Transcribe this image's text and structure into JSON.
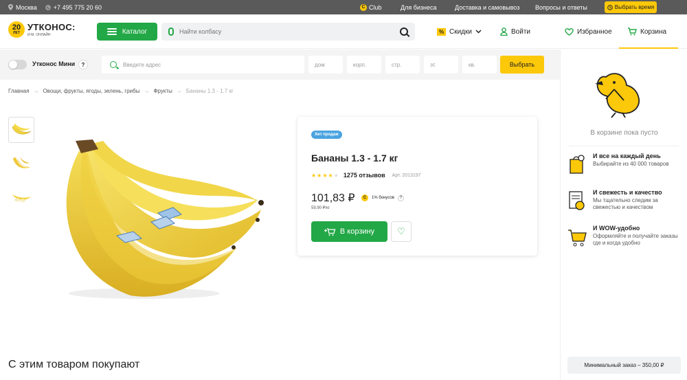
{
  "topbar": {
    "city": "Москва",
    "phone": "+7 495 775 20 60",
    "club": "Club",
    "business": "Для бизнеса",
    "delivery": "Доставка и самовывоз",
    "faq": "Вопросы и ответы",
    "time_btn": "Выбрать время"
  },
  "header": {
    "logo_badge": "20",
    "logo_badge_sub": "ЛЕТ",
    "logo_name": "УТКОНОС:",
    "logo_sub": "И-М. ОНЛАЙН",
    "catalog": "Каталог",
    "search_placeholder": "Найти колбасу",
    "sales_icon": "%",
    "sales": "Скидки",
    "login": "Войти",
    "favorites": "Избранное",
    "cart": "Корзина"
  },
  "address": {
    "mini_label": "Утконос Мини",
    "help": "?",
    "address_placeholder": "Введите адрес",
    "house": "дом",
    "building": "корп.",
    "structure": "стр.",
    "floor": "эт.",
    "apartment": "кв.",
    "choose": "Выбрать"
  },
  "breadcrumbs": [
    "Главная",
    "Овощи, фрукты, ягоды, зелень, грибы",
    "Фрукты",
    "Бананы 1.3 - 1.7 кг"
  ],
  "breadcrumb_sep": "→",
  "product": {
    "badge": "Хит продаж",
    "title": "Бананы 1.3 - 1.7 кг",
    "rating": 4,
    "rating_max": 5,
    "reviews": "1275 отзывов",
    "article": "Арт. 2013197",
    "price": "101,83 ₽",
    "unit_price": "59,90 ₽/кг",
    "bonus": "1% бонусов",
    "bonus_icon": "C",
    "bonus_help": "?",
    "to_cart": "В корзину",
    "fav_icon": "♡"
  },
  "also_bought": "С этим товаром покупают",
  "sidebar": {
    "empty": "В корзине пока пусто",
    "features": [
      {
        "title": "И все на каждый день",
        "text": "Выбирайте из 40 000 товаров"
      },
      {
        "title": "И свежесть и качество",
        "text": "Мы тщательно следим за свежестью и качеством"
      },
      {
        "title": "И WOW-удобно",
        "text": "Оформляйте и получайте заказы где и когда удобно"
      }
    ],
    "min_order": "Минимальный заказ – 350,00 ₽"
  },
  "colors": {
    "green": "#22a846",
    "yellow": "#fcc80a",
    "blue": "#4aa3e0"
  }
}
